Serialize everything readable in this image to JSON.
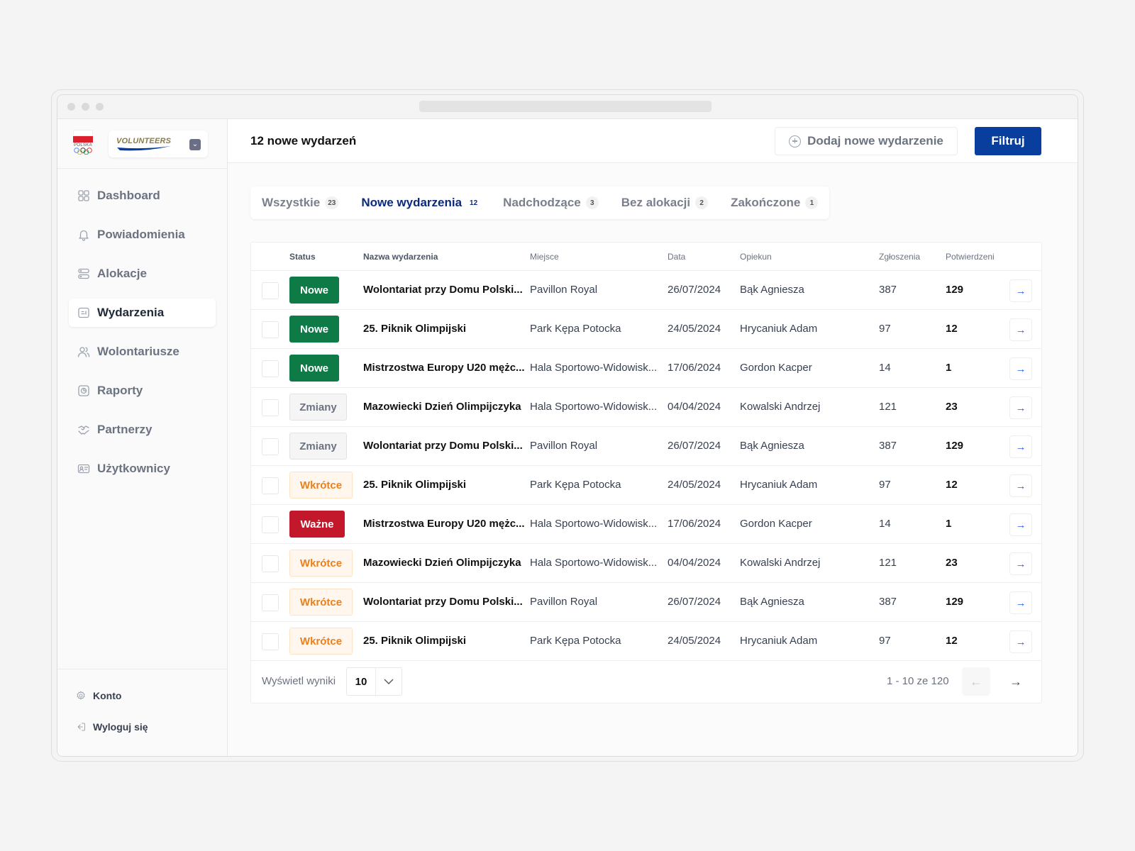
{
  "brand": {
    "country_label": "POLSKA",
    "product_name": "VOLUNTEERS"
  },
  "sidebar": {
    "items": [
      {
        "label": "Dashboard",
        "icon": "grid-icon"
      },
      {
        "label": "Powiadomienia",
        "icon": "bell-icon"
      },
      {
        "label": "Alokacje",
        "icon": "server-icon"
      },
      {
        "label": "Wydarzenia",
        "icon": "calendar-icon",
        "active": true
      },
      {
        "label": "Wolontariusze",
        "icon": "users-icon"
      },
      {
        "label": "Raporty",
        "icon": "report-icon"
      },
      {
        "label": "Partnerzy",
        "icon": "handshake-icon"
      },
      {
        "label": "Użytkownicy",
        "icon": "id-card-icon"
      }
    ],
    "bottom": [
      {
        "label": "Konto",
        "icon": "gear-icon"
      },
      {
        "label": "Wyloguj się",
        "icon": "logout-icon"
      }
    ]
  },
  "header": {
    "title": "12 nowe wydarzeń",
    "add_button": "Dodaj nowe wydarzenie",
    "filter_button": "Filtruj"
  },
  "tabs": [
    {
      "label": "Wszystkie",
      "count": "23"
    },
    {
      "label": "Nowe wydarzenia",
      "count": "12",
      "active": true
    },
    {
      "label": "Nadchodzące",
      "count": "3"
    },
    {
      "label": "Bez alokacji",
      "count": "2"
    },
    {
      "label": "Zakończone",
      "count": "1"
    }
  ],
  "table": {
    "columns": [
      "Status",
      "Nazwa wydarzenia",
      "Miejsce",
      "Data",
      "Opiekun",
      "Zgłoszenia",
      "Potwierdzeni"
    ],
    "rows": [
      {
        "status": "Nowe",
        "kind": "nowe",
        "name": "Wolontariat przy Domu Polski...",
        "place": "Pavillon Royal",
        "date": "26/07/2024",
        "owner": "Bąk Agniesza",
        "apps": "387",
        "confirmed": "129"
      },
      {
        "status": "Nowe",
        "kind": "nowe",
        "name": "25. Piknik Olimpijski",
        "place": "Park Kępa Potocka",
        "date": "24/05/2024",
        "owner": "Hrycaniuk Adam",
        "apps": "97",
        "confirmed": "12"
      },
      {
        "status": "Nowe",
        "kind": "nowe",
        "name": "Mistrzostwa Europy U20 mężc...",
        "place": "Hala Sportowo-Widowisk...",
        "date": "17/06/2024",
        "owner": "Gordon Kacper",
        "apps": "14",
        "confirmed": "1"
      },
      {
        "status": "Zmiany",
        "kind": "zmiany",
        "name": "Mazowiecki Dzień Olimpijczyka",
        "place": "Hala Sportowo-Widowisk...",
        "date": "04/04/2024",
        "owner": "Kowalski Andrzej",
        "apps": "121",
        "confirmed": "23"
      },
      {
        "status": "Zmiany",
        "kind": "zmiany",
        "name": "Wolontariat przy Domu Polski...",
        "place": "Pavillon Royal",
        "date": "26/07/2024",
        "owner": "Bąk Agniesza",
        "apps": "387",
        "confirmed": "129"
      },
      {
        "status": "Wkrótce",
        "kind": "wkrotce",
        "name": "25. Piknik Olimpijski",
        "place": "Park Kępa Potocka",
        "date": "24/05/2024",
        "owner": "Hrycaniuk Adam",
        "apps": "97",
        "confirmed": "12"
      },
      {
        "status": "Ważne",
        "kind": "wazne",
        "name": "Mistrzostwa Europy U20 mężc...",
        "place": "Hala Sportowo-Widowisk...",
        "date": "17/06/2024",
        "owner": "Gordon Kacper",
        "apps": "14",
        "confirmed": "1"
      },
      {
        "status": "Wkrótce",
        "kind": "wkrotce",
        "name": "Mazowiecki Dzień Olimpijczyka",
        "place": "Hala Sportowo-Widowisk...",
        "date": "04/04/2024",
        "owner": "Kowalski Andrzej",
        "apps": "121",
        "confirmed": "23"
      },
      {
        "status": "Wkrótce",
        "kind": "wkrotce",
        "name": "Wolontariat przy Domu Polski...",
        "place": "Pavillon Royal",
        "date": "26/07/2024",
        "owner": "Bąk Agniesza",
        "apps": "387",
        "confirmed": "129"
      },
      {
        "status": "Wkrótce",
        "kind": "wkrotce",
        "name": "25. Piknik Olimpijski",
        "place": "Park Kępa Potocka",
        "date": "24/05/2024",
        "owner": "Hrycaniuk Adam",
        "apps": "97",
        "confirmed": "12"
      }
    ]
  },
  "pagination": {
    "per_page_label": "Wyświetl wyniki",
    "per_page_value": "10",
    "range": "1 - 10 ze 120"
  },
  "colors": {
    "primary": "#0a3e9e",
    "status_new": "#0e7a46",
    "status_important": "#c3182b",
    "status_soon": "#ea7f1e",
    "status_changes": "#6b7280"
  }
}
